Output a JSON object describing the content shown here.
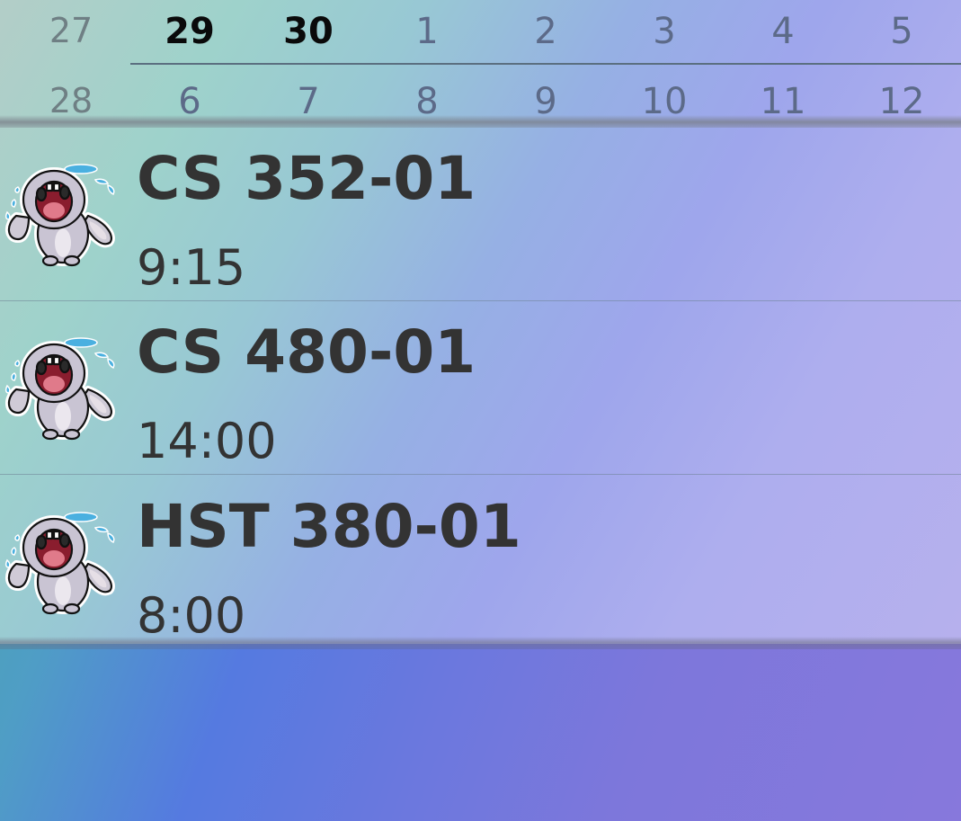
{
  "calendar": {
    "week_numbers": [
      "27",
      "28"
    ],
    "week1": [
      {
        "label": "29",
        "bold": true
      },
      {
        "label": "30",
        "bold": true
      },
      {
        "label": "1",
        "bold": false
      },
      {
        "label": "2",
        "bold": false
      },
      {
        "label": "3",
        "bold": false
      },
      {
        "label": "4",
        "bold": false
      },
      {
        "label": "5",
        "bold": false
      }
    ],
    "week2": [
      {
        "label": "6",
        "bold": false
      },
      {
        "label": "7",
        "bold": false
      },
      {
        "label": "8",
        "bold": false
      },
      {
        "label": "9",
        "bold": false
      },
      {
        "label": "10",
        "bold": false
      },
      {
        "label": "11",
        "bold": false
      },
      {
        "label": "12",
        "bold": false
      }
    ]
  },
  "courses": [
    {
      "title": "CS 352-01",
      "time": "9:15",
      "icon": "crying-bunny-icon"
    },
    {
      "title": "CS 480-01",
      "time": "14:00",
      "icon": "crying-bunny-icon"
    },
    {
      "title": "HST 380-01",
      "time": "8:00",
      "icon": "crying-bunny-icon"
    }
  ],
  "colors": {
    "selected_day": "#0a0a0a",
    "day_text": "#5c6a88",
    "week_number_text": "#6f7f84",
    "course_text": "#333333"
  }
}
